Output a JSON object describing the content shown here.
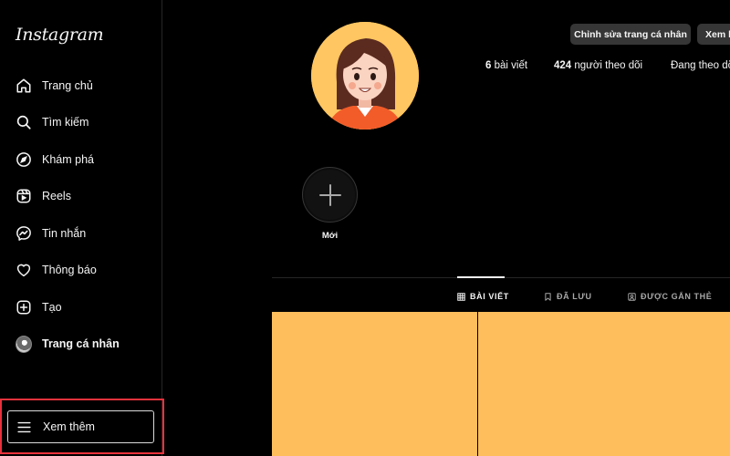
{
  "app": {
    "logo": "Instagram"
  },
  "sidebar": {
    "items": [
      {
        "label": "Trang chủ",
        "icon": "home-icon"
      },
      {
        "label": "Tìm kiếm",
        "icon": "search-icon"
      },
      {
        "label": "Khám phá",
        "icon": "compass-icon"
      },
      {
        "label": "Reels",
        "icon": "reels-icon"
      },
      {
        "label": "Tin nhắn",
        "icon": "messenger-icon"
      },
      {
        "label": "Thông báo",
        "icon": "heart-icon"
      },
      {
        "label": "Tạo",
        "icon": "plus-square-icon"
      },
      {
        "label": "Trang cá nhân",
        "icon": "profile-avatar-icon"
      }
    ],
    "more_label": "Xem thêm",
    "highlight_color": "#e8323c"
  },
  "profile": {
    "edit_button": "Chỉnh sửa trang cá nhân",
    "archive_button": "Xem k",
    "stats": {
      "posts_count": "6",
      "posts_label": "bài viết",
      "followers_count": "424",
      "followers_label": "người theo dõi",
      "following_label": "Đang theo dõ"
    },
    "new_highlight_label": "Mới"
  },
  "tabs": [
    {
      "label": "BÀI VIẾT",
      "icon": "grid-icon",
      "active": true
    },
    {
      "label": "ĐÃ LƯU",
      "icon": "bookmark-icon",
      "active": false
    },
    {
      "label": "ĐƯỢC GẮN THẺ",
      "icon": "tagged-icon",
      "active": false
    }
  ],
  "colors": {
    "background": "#000000",
    "post_tile": "#ffbe5c",
    "button": "#363636"
  }
}
